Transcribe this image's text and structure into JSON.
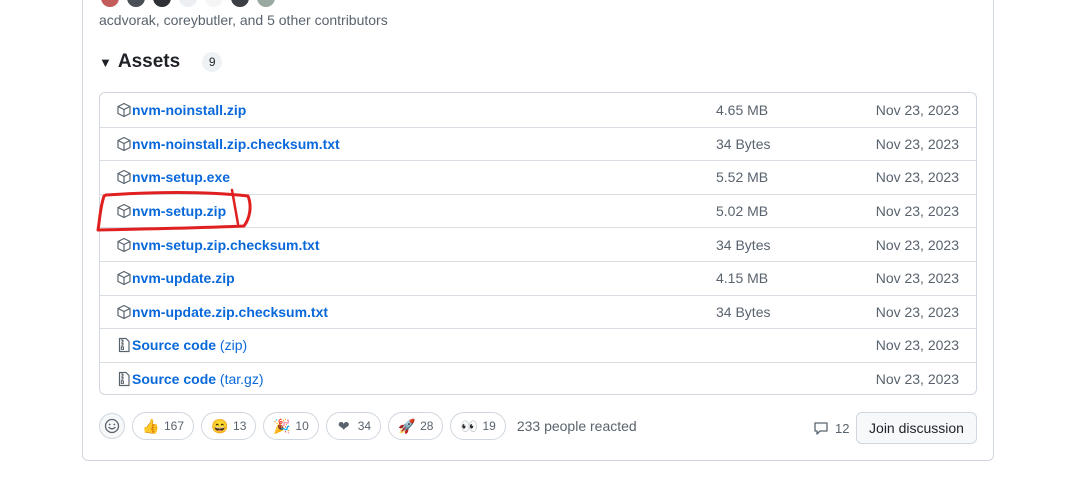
{
  "contributors_text": "acdvorak, coreybutler, and 5 other contributors",
  "assets": {
    "title": "Assets",
    "count": "9",
    "rows": [
      {
        "name": "nvm-noinstall.zip",
        "ext": "",
        "size": "4.65 MB",
        "date": "Nov 23, 2023",
        "icon": "package-icon"
      },
      {
        "name": "nvm-noinstall.zip.checksum.txt",
        "ext": "",
        "size": "34 Bytes",
        "date": "Nov 23, 2023",
        "icon": "package-icon"
      },
      {
        "name": "nvm-setup.exe",
        "ext": "",
        "size": "5.52 MB",
        "date": "Nov 23, 2023",
        "icon": "package-icon"
      },
      {
        "name": "nvm-setup.zip",
        "ext": "",
        "size": "5.02 MB",
        "date": "Nov 23, 2023",
        "icon": "package-icon"
      },
      {
        "name": "nvm-setup.zip.checksum.txt",
        "ext": "",
        "size": "34 Bytes",
        "date": "Nov 23, 2023",
        "icon": "package-icon"
      },
      {
        "name": "nvm-update.zip",
        "ext": "",
        "size": "4.15 MB",
        "date": "Nov 23, 2023",
        "icon": "package-icon"
      },
      {
        "name": "nvm-update.zip.checksum.txt",
        "ext": "",
        "size": "34 Bytes",
        "date": "Nov 23, 2023",
        "icon": "package-icon"
      },
      {
        "name": "Source code",
        "ext": "(zip)",
        "size": "",
        "date": "Nov 23, 2023",
        "icon": "file-zip-icon"
      },
      {
        "name": "Source code",
        "ext": "(tar.gz)",
        "size": "",
        "date": "Nov 23, 2023",
        "icon": "file-zip-icon"
      }
    ]
  },
  "reactions": {
    "items": [
      {
        "emoji": "👍",
        "count": "167",
        "name": "thumbs-up"
      },
      {
        "emoji": "😄",
        "count": "13",
        "name": "laugh"
      },
      {
        "emoji": "🎉",
        "count": "10",
        "name": "hooray"
      },
      {
        "emoji": "❤",
        "count": "34",
        "name": "heart"
      },
      {
        "emoji": "🚀",
        "count": "28",
        "name": "rocket"
      },
      {
        "emoji": "👀",
        "count": "19",
        "name": "eyes"
      }
    ],
    "summary": "233 people reacted"
  },
  "discussion": {
    "comment_count": "12",
    "join_label": "Join discussion"
  },
  "colors": {
    "link": "#0969da",
    "muted": "#59636e",
    "border": "#d0d7de",
    "annotation": "#e02020"
  }
}
